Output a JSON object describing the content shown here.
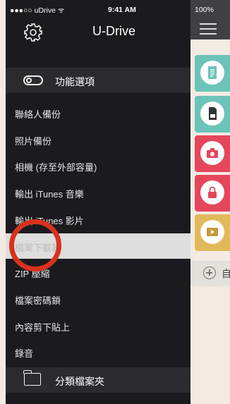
{
  "status_bar": {
    "carrier": "●●●○○ uDrive ᯤ",
    "time": "9:41 AM",
    "battery": "100%"
  },
  "drawer": {
    "title": "U-Drive",
    "section_options": "功能選項",
    "items": [
      {
        "label": "聯絡人備份"
      },
      {
        "label": "照片備份"
      },
      {
        "label": "相機 (存至外部容量)"
      },
      {
        "label": "輸出 iTunes 音樂"
      },
      {
        "label": "輸出 iTunes 影片"
      },
      {
        "label": "檔案下載器"
      },
      {
        "label": "ZIP 壓縮"
      },
      {
        "label": "檔案密碼鎖"
      },
      {
        "label": "內容剪下貼上"
      },
      {
        "label": "錄音"
      }
    ],
    "section_folders": "分類檔案夾",
    "selected_index": 5
  },
  "main": {
    "add_label": "自",
    "tiles": [
      {
        "icon": "document-icon",
        "color": "#6cc3b8"
      },
      {
        "icon": "sd-card-icon",
        "color": "#6cc3b8"
      },
      {
        "icon": "camera-icon",
        "color": "#e5465c"
      },
      {
        "icon": "lock-icon",
        "color": "#e5465c"
      },
      {
        "icon": "video-icon",
        "color": "#e2b95a"
      }
    ]
  },
  "colors": {
    "drawer_bg": "#1b1b1f",
    "section_bg": "#2b2b2f",
    "selected_bg": "#dedede",
    "annotation": "#d8321f"
  }
}
